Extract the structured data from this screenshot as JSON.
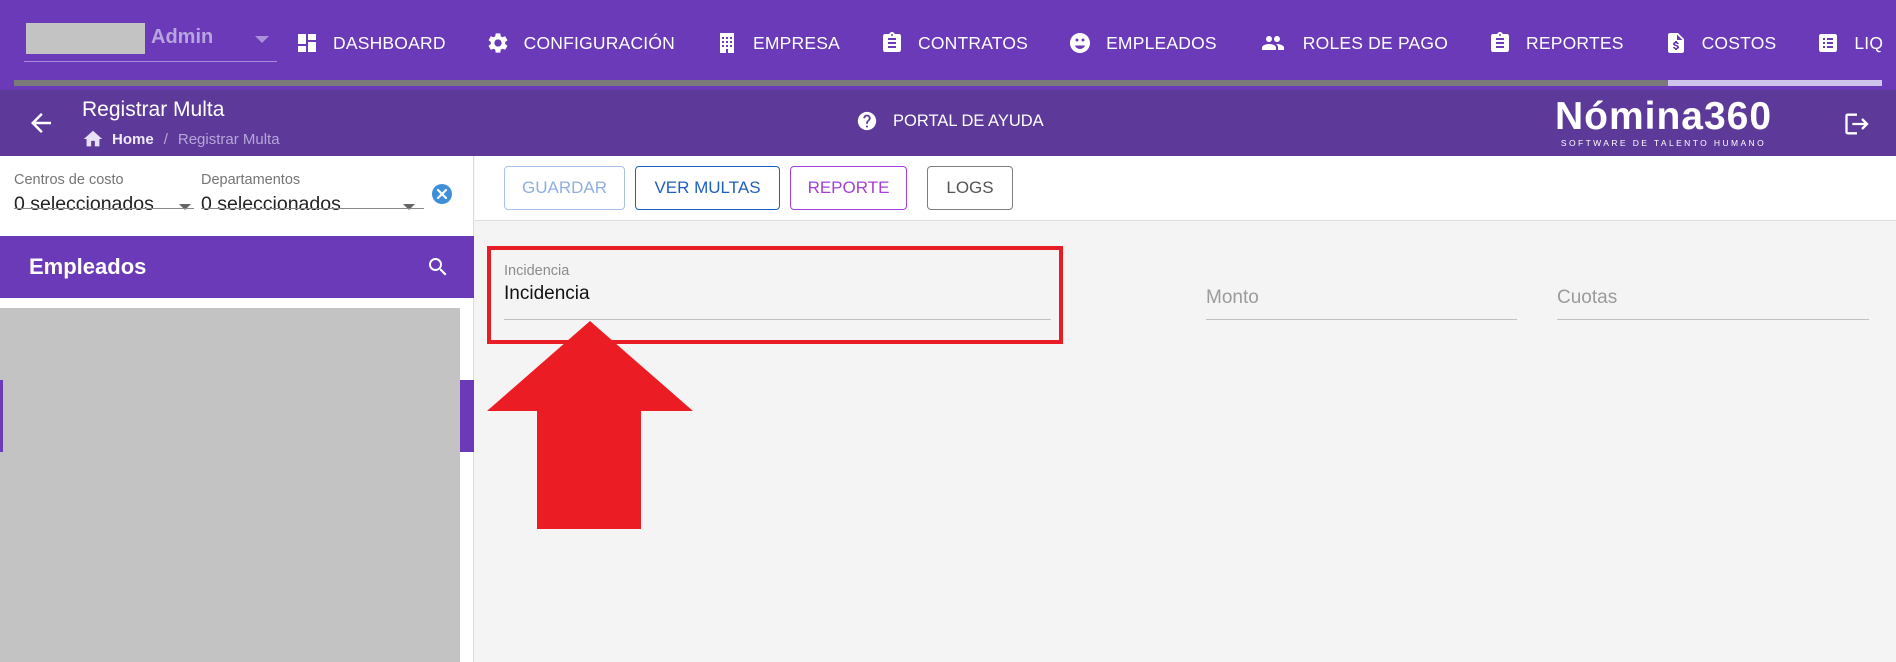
{
  "topnav": {
    "account": {
      "name": "Admin"
    },
    "items": [
      {
        "label": "DASHBOARD",
        "icon": "dashboard-icon"
      },
      {
        "label": "CONFIGURACIÓN",
        "icon": "gear-icon"
      },
      {
        "label": "EMPRESA",
        "icon": "building-icon"
      },
      {
        "label": "CONTRATOS",
        "icon": "clipboard-icon"
      },
      {
        "label": "EMPLEADOS",
        "icon": "face-icon"
      },
      {
        "label": "ROLES DE PAGO",
        "icon": "people-icon"
      },
      {
        "label": "REPORTES",
        "icon": "clipboard-list-icon"
      },
      {
        "label": "COSTOS",
        "icon": "dollar-file-icon"
      },
      {
        "label": "LIQUIDACIONE",
        "icon": "list-icon"
      }
    ]
  },
  "subheader": {
    "title": "Registrar Multa",
    "breadcrumb": {
      "home": "Home",
      "separator": "/",
      "current": "Registrar Multa"
    },
    "help": "PORTAL DE AYUDA",
    "logo": {
      "main": "Nómina360",
      "sub": "SOFTWARE DE TALENTO HUMANO"
    }
  },
  "sidebar": {
    "filters": [
      {
        "label": "Centros de costo",
        "value": "0 seleccionados"
      },
      {
        "label": "Departamentos",
        "value": "0 seleccionados"
      }
    ],
    "employees_title": "Empleados"
  },
  "toolbar": {
    "guardar": "GUARDAR",
    "ver_multas": "VER MULTAS",
    "reporte": "REPORTE",
    "logs": "LOGS"
  },
  "form": {
    "incidencia": {
      "label": "Incidencia",
      "value": "Incidencia"
    },
    "monto": {
      "placeholder": "Monto"
    },
    "cuotas": {
      "placeholder": "Cuotas"
    }
  },
  "colors": {
    "primary": "#6a3ab8",
    "subheader": "#5d3a9a",
    "highlight": "#e71c24",
    "ver_multas": "#1f5fbf",
    "reporte": "#a53fd6"
  }
}
